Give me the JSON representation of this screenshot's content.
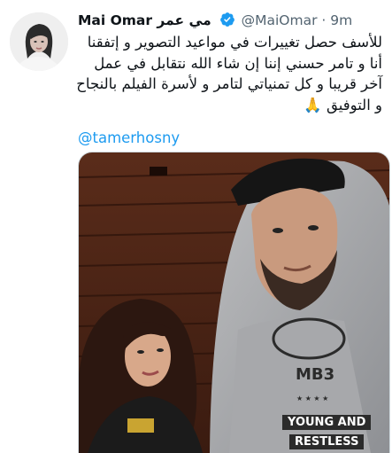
{
  "tweet": {
    "author_name": "Mai Omar مي عمر",
    "handle": "@MaiOmar",
    "separator": "·",
    "time": "9m",
    "text_lines": [
      "للأسف حصل تغييرات في مواعيد التصوير و إتفقنا",
      "أنا و تامر حسني إننا إن شاء الله نتقابل في عمل",
      "آخر قريبا و كل تمنياتي لتامر و لأسرة الفيلم بالنجاح",
      "و التوفيق 🙏"
    ],
    "mention": "@tamerhosny"
  },
  "photo": {
    "hoodie_text_top": "MB3",
    "hoodie_text_bottom_1": "YOUNG AND",
    "hoodie_text_bottom_2": "RESTLESS"
  },
  "colors": {
    "text": "#0f1419",
    "secondary": "#536471",
    "link": "#1d9bf0",
    "verified": "#1d9bf0"
  },
  "icons": {
    "verified": "verified-badge-icon"
  }
}
